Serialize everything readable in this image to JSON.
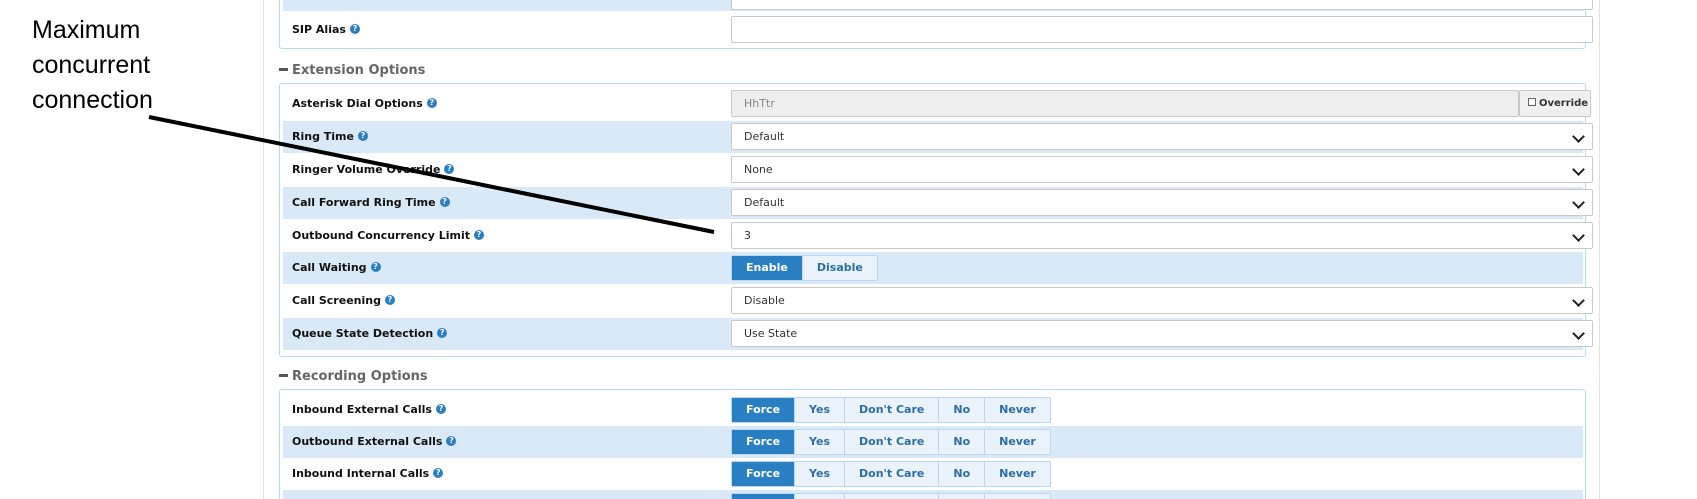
{
  "annotation": {
    "lines": [
      "Maximum",
      "concurrent",
      "connection"
    ]
  },
  "top_rows": {
    "sip_alias_label": "SIP Alias",
    "sip_alias_value": ""
  },
  "extension_options": {
    "title": "Extension Options",
    "asterisk_dial": {
      "label": "Asterisk Dial Options",
      "value": "HhTtr",
      "override_label": "Override"
    },
    "ring_time": {
      "label": "Ring Time",
      "value": "Default"
    },
    "ringer_volume": {
      "label": "Ringer Volume Override",
      "value": "None"
    },
    "call_forward_ring": {
      "label": "Call Forward Ring Time",
      "value": "Default"
    },
    "outbound_limit": {
      "label": "Outbound Concurrency Limit",
      "value": "3"
    },
    "call_waiting": {
      "label": "Call Waiting",
      "options": [
        "Enable",
        "Disable"
      ],
      "selected": "Enable"
    },
    "call_screening": {
      "label": "Call Screening",
      "value": "Disable"
    },
    "queue_state": {
      "label": "Queue State Detection",
      "value": "Use State"
    }
  },
  "recording_options": {
    "title": "Recording Options",
    "options": [
      "Force",
      "Yes",
      "Don't Care",
      "No",
      "Never"
    ],
    "rows": [
      {
        "label": "Inbound External Calls",
        "selected": "Force"
      },
      {
        "label": "Outbound External Calls",
        "selected": "Force"
      },
      {
        "label": "Inbound Internal Calls",
        "selected": "Force"
      }
    ]
  },
  "colors": {
    "accent": "#2a7fc2",
    "row_highlight": "#d9e9f7",
    "box_border": "#b8daf0"
  }
}
